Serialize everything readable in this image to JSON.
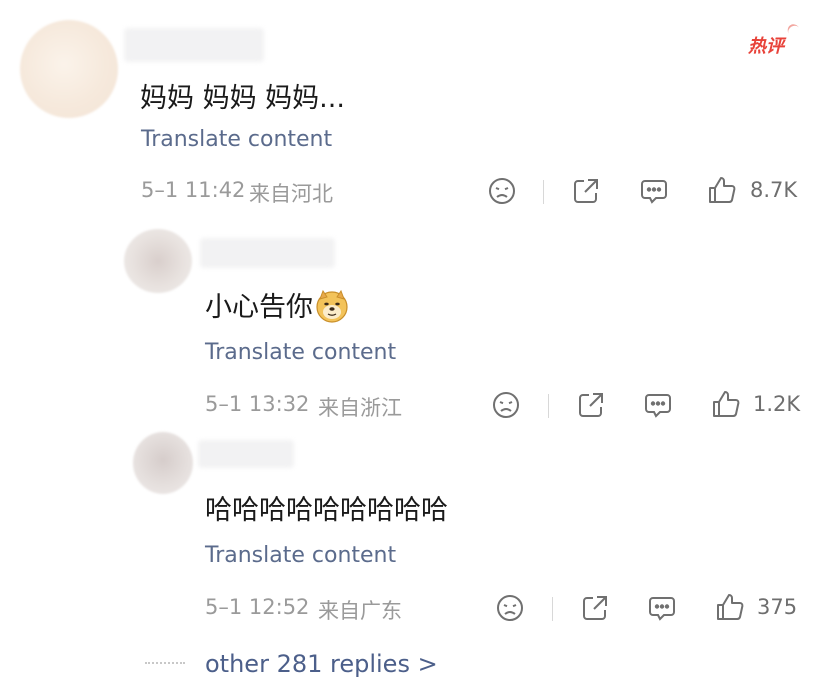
{
  "hot_badge": "热评",
  "comments": [
    {
      "text": "妈妈 妈妈 妈妈...",
      "translate": "Translate content",
      "date": "5–1 11:42",
      "location": "来自河北",
      "likes": "8.7K"
    },
    {
      "text": "小心告你",
      "translate": "Translate content",
      "date": "5–1 13:32",
      "location": "来自浙江",
      "likes": "1.2K",
      "emoji": "doge-emoji"
    },
    {
      "text": "哈哈哈哈哈哈哈哈哈",
      "translate": "Translate content",
      "date": "5–1 12:52",
      "location": "来自广东",
      "likes": "375"
    }
  ],
  "more_replies": "other 281 replies >",
  "icons": {
    "dislike": "sad-face-icon",
    "share": "share-icon",
    "reply": "comment-icon",
    "like": "thumbs-up-icon"
  },
  "colors": {
    "accent_link": "#5b6b8c",
    "hot_badge": "#e8433a",
    "meta_text": "#9a9a9a"
  }
}
